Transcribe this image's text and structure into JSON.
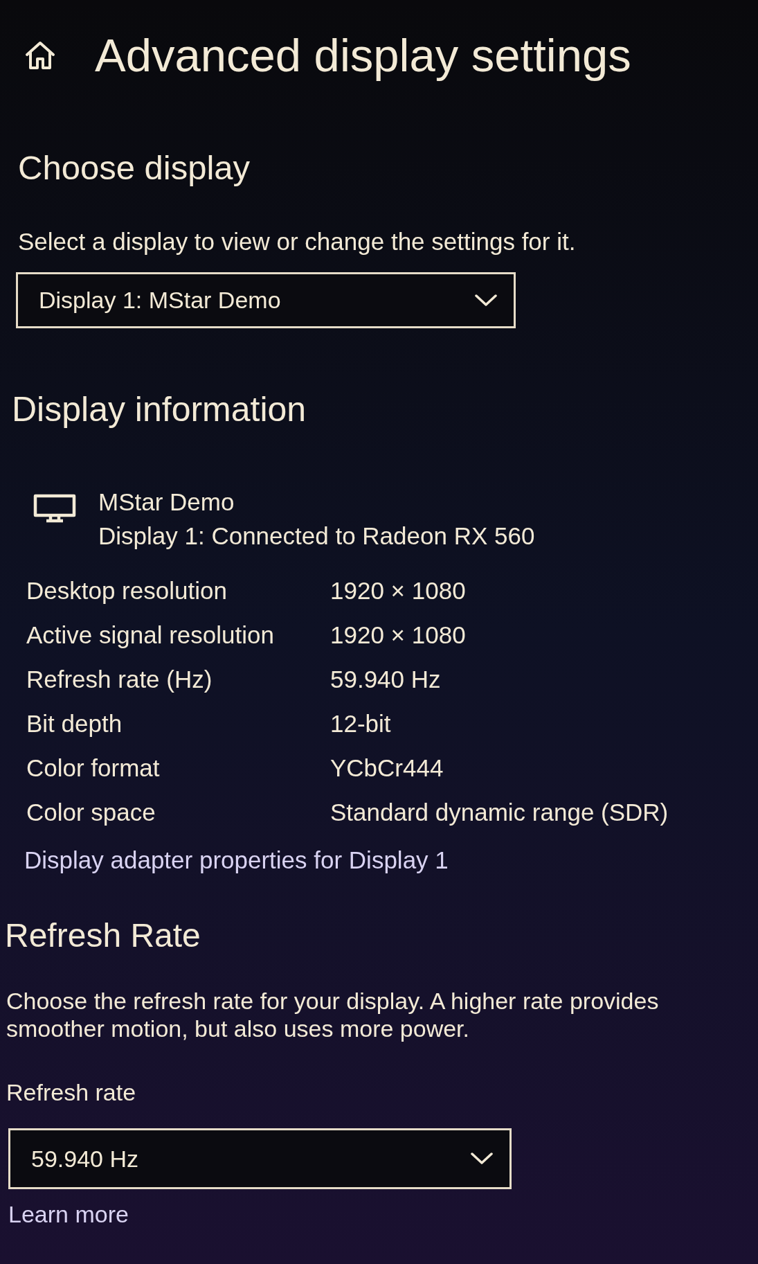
{
  "page": {
    "title": "Advanced display settings"
  },
  "choose_display": {
    "heading": "Choose display",
    "description": "Select a display to view or change the settings for it.",
    "dropdown": {
      "value": "Display 1: MStar Demo"
    }
  },
  "display_information": {
    "heading": "Display information",
    "device": {
      "name": "MStar Demo",
      "detail": "Display 1: Connected to Radeon RX 560"
    },
    "rows": [
      {
        "label": "Desktop resolution",
        "value": "1920 × 1080"
      },
      {
        "label": "Active signal resolution",
        "value": "1920 × 1080"
      },
      {
        "label": "Refresh rate (Hz)",
        "value": "59.940 Hz"
      },
      {
        "label": "Bit depth",
        "value": "12-bit"
      },
      {
        "label": "Color format",
        "value": "YCbCr444"
      },
      {
        "label": "Color space",
        "value": "Standard dynamic range (SDR)"
      }
    ],
    "link": "Display adapter properties for Display 1"
  },
  "refresh_rate": {
    "heading": "Refresh Rate",
    "description": "Choose the refresh rate for your display. A higher rate provides smoother motion, but also uses more power.",
    "label": "Refresh rate",
    "dropdown": {
      "value": "59.940 Hz"
    },
    "link": "Learn more"
  }
}
